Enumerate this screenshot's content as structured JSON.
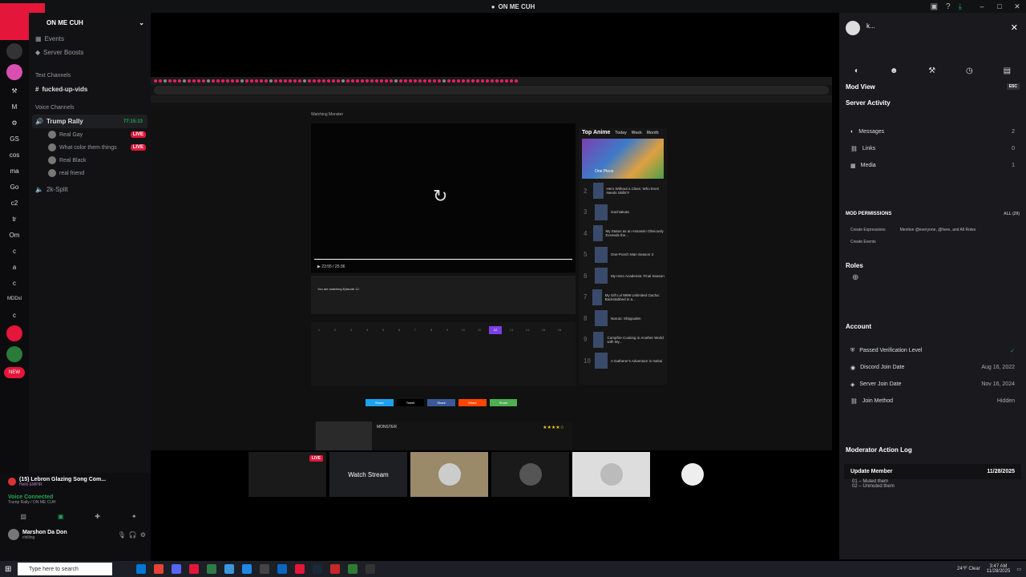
{
  "window": {
    "title": "ON ME CUH"
  },
  "server": {
    "name": "ON ME CUH",
    "items": [
      "Events",
      "Server Boosts"
    ],
    "text_category": "Text Channels",
    "text_channel": "fucked-up-vids",
    "voice_category": "Voice Channels",
    "voice_channel": "Trump Rally",
    "voice_timer": "77:15:13",
    "voice_users": [
      {
        "name": "Real Gay",
        "live": "LIVE"
      },
      {
        "name": "What color them things",
        "live": "LIVE"
      },
      {
        "name": "Real Black"
      },
      {
        "name": "real friend"
      }
    ],
    "other_voice": "2k-Split"
  },
  "rail": [
    "GS",
    "cos",
    "ma",
    "Go",
    "c2",
    "tr",
    "Om",
    "c",
    "a",
    "c",
    "MDDsl",
    "c",
    "NEW"
  ],
  "bottom": {
    "activity": "(15) Lebron Glazing Song Com...",
    "activity_sub": "Hello EMPIR",
    "voice_status": "Voice Connected",
    "voice_location": "Trump Rally / ON ME CUH",
    "user": "Marshon Da Don",
    "user_status": "chilling"
  },
  "stream": {
    "tab_count": "4",
    "page_title": "Watching Monster",
    "top_anime": "Top Anime",
    "top_tabs": [
      "Today",
      "Week",
      "Month"
    ],
    "featured": "One Piece",
    "list": [
      "Hero Without a Class: Who Even Needs Skills?!",
      "Gachiakuta",
      "My Status as an Assassin Obviously Exceeds the...",
      "One-Punch Man Season 3",
      "My Hero Academia: Final Season",
      "My Gift Lvl 9999 Unlimited Gacha: Backstabbed in a...",
      "Naruto: Shippuden",
      "Campfire Cooking in Another World with My...",
      "A Gatherer's Adventure in Isekai"
    ],
    "current_ep": "12",
    "watching_msg": "You are watching Episode 12.",
    "share_buttons": [
      "Share",
      "Tweet",
      "Share",
      "Share",
      "Share"
    ],
    "title": "MONSTER",
    "stars": "★★★★☆",
    "time": "23:55 / 25:36"
  },
  "thumbs": {
    "live": "LIVE",
    "watch": "Watch Stream"
  },
  "modview": {
    "user": "k...",
    "title": "Mod View",
    "esc": "ESC",
    "activity": "Server Activity",
    "rows": [
      {
        "label": "Messages",
        "value": "2"
      },
      {
        "label": "Links",
        "value": "0"
      },
      {
        "label": "Media",
        "value": "1"
      }
    ],
    "perm_title": "MOD PERMISSIONS",
    "perm_all": "ALL (29)",
    "perms": [
      "Create Expressions",
      "Mention @everyone, @here, and All Roles",
      "Create Events"
    ],
    "roles": "Roles",
    "account": "Account",
    "account_rows": [
      {
        "label": "Passed Verification Level",
        "value": "✓"
      },
      {
        "label": "Discord Join Date",
        "value": "Aug 16, 2022"
      },
      {
        "label": "Server Join Date",
        "value": "Nov 16, 2024"
      },
      {
        "label": "Join Method",
        "value": "Hidden"
      }
    ],
    "log_title": "Moderator Action Log",
    "log_entry": "Update Member",
    "log_date": "11/28/2025",
    "log_items": [
      "01 – Muted them",
      "02 – Unmuted them"
    ]
  },
  "taskbar": {
    "search": "Type here to search",
    "weather": "24°F Clear",
    "time": "3:47 AM",
    "date": "11/28/2025"
  }
}
